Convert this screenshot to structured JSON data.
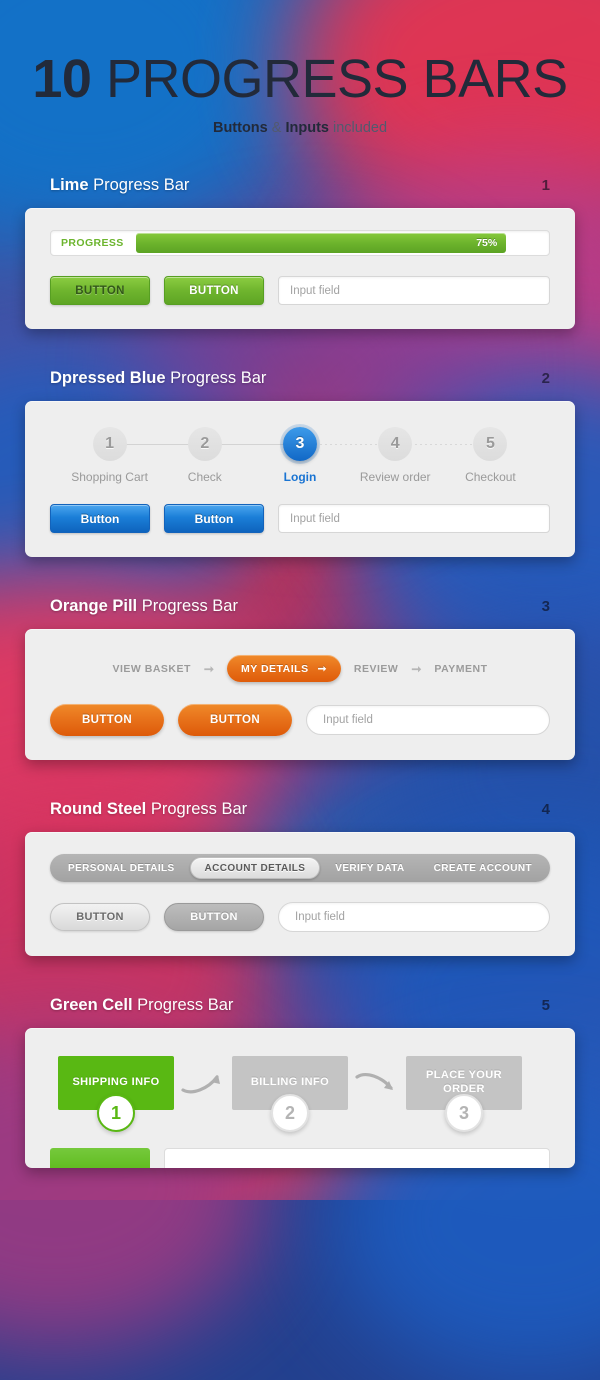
{
  "header": {
    "title_bold": "10",
    "title_rest": " PROGRESS BARS",
    "sub_b1": "Buttons",
    "sub_amp": " & ",
    "sub_b2": "Inputs",
    "sub_tail": " included"
  },
  "colors": {
    "lime": "#6cb32c",
    "blue": "#1168c6",
    "orange": "#e8731b",
    "steel": "#a2a2a2",
    "green_cell": "#59b813",
    "bg_blue": "#1566bd",
    "bg_red": "#d6325a"
  },
  "sections": [
    {
      "num": "1",
      "title_bold": "Lime",
      "title_rest": " Progress Bar",
      "progress": {
        "label": "PROGRESS",
        "percent_label": "75%",
        "percent_value": 75
      },
      "buttons": [
        "BUTTON",
        "BUTTON"
      ],
      "input_placeholder": "Input field"
    },
    {
      "num": "2",
      "title_bold": "Dpressed Blue",
      "title_rest": " Progress Bar",
      "steps": [
        {
          "num": "1",
          "label": "Shopping Cart",
          "active": false
        },
        {
          "num": "2",
          "label": "Check",
          "active": false
        },
        {
          "num": "3",
          "label": "Login",
          "active": true
        },
        {
          "num": "4",
          "label": "Review order",
          "active": false
        },
        {
          "num": "5",
          "label": "Checkout",
          "active": false
        }
      ],
      "buttons": [
        "Button",
        "Button"
      ],
      "input_placeholder": "Input field"
    },
    {
      "num": "3",
      "title_bold": "Orange Pill",
      "title_rest": " Progress Bar",
      "pills": [
        {
          "label": "VIEW BASKET",
          "active": false
        },
        {
          "label": "MY DETAILS",
          "active": true
        },
        {
          "label": "REVIEW",
          "active": false
        },
        {
          "label": "PAYMENT",
          "active": false
        }
      ],
      "separator_icon": "arrow-right-icon",
      "buttons": [
        "BUTTON",
        "BUTTON"
      ],
      "input_placeholder": "Input field"
    },
    {
      "num": "4",
      "title_bold": "Round Steel",
      "title_rest": " Progress Bar",
      "items": [
        {
          "label": "PERSONAL DETAILS",
          "active": false
        },
        {
          "label": "ACCOUNT DETAILS",
          "active": true
        },
        {
          "label": "VERIFY DATA",
          "active": false
        },
        {
          "label": "CREATE ACCOUNT",
          "active": false
        }
      ],
      "buttons": [
        "BUTTON",
        "BUTTON"
      ],
      "input_placeholder": "Input field"
    },
    {
      "num": "5",
      "title_bold": "Green Cell",
      "title_rest": " Progress Bar",
      "cells": [
        {
          "label": "SHIPPING INFO",
          "badge": "1",
          "active": true
        },
        {
          "label": "BILLING INFO",
          "badge": "2",
          "active": false
        },
        {
          "label": "PLACE YOUR ORDER",
          "badge": "3",
          "active": false
        }
      ],
      "arrow_icon": "curved-arrow-right-icon"
    }
  ]
}
